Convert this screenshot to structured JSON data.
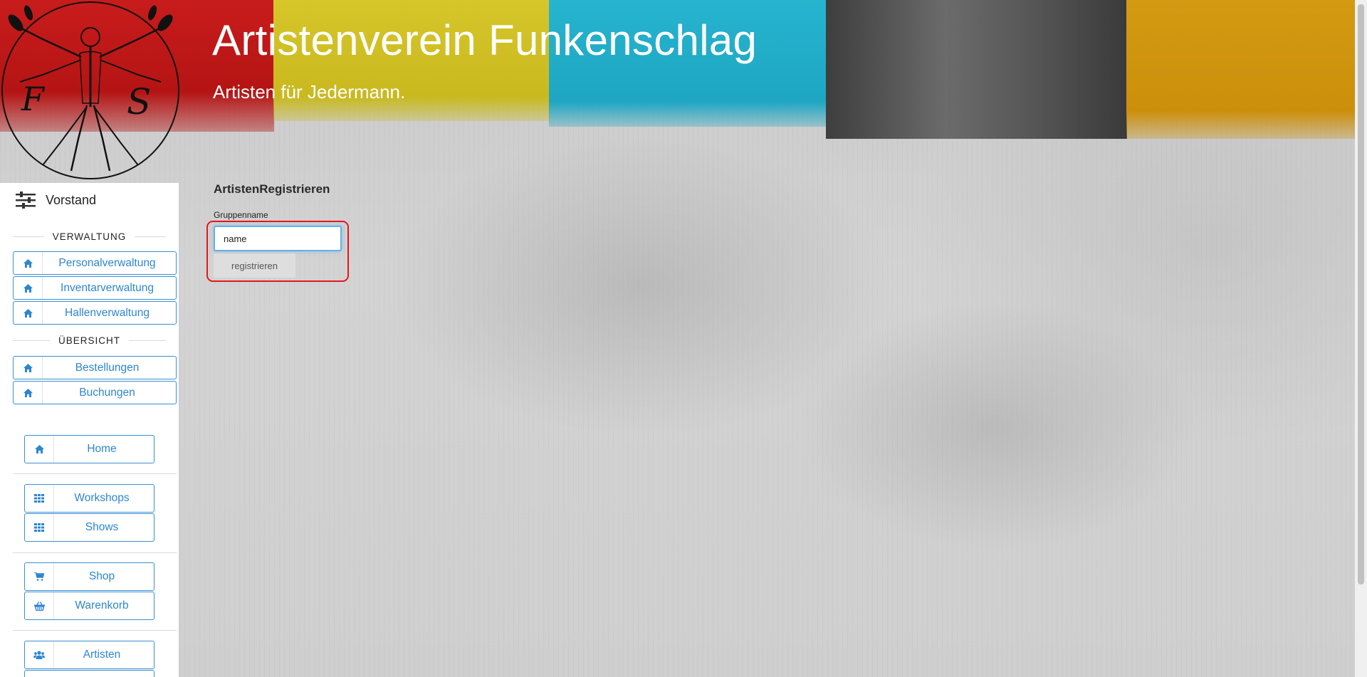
{
  "header": {
    "title": "Artistenverein Funkenschlag",
    "subtitle": "Artisten für Jedermann."
  },
  "sidebar": {
    "heading": "Vorstand",
    "section_admin": "VERWALTUNG",
    "section_overview": "ÜBERSICHT",
    "admin_items": [
      "Personalverwaltung",
      "Inventarverwaltung",
      "Hallenverwaltung"
    ],
    "overview_items": [
      "Bestellungen",
      "Buchungen"
    ],
    "nav": {
      "home": "Home",
      "workshops": "Workshops",
      "shows": "Shows",
      "shop": "Shop",
      "cart": "Warenkorb",
      "artists": "Artisten"
    }
  },
  "main": {
    "title": "ArtistenRegistrieren",
    "field_label": "Gruppenname",
    "input_value": "name",
    "submit_label": "registrieren"
  },
  "colors": {
    "link": "#2e86d1",
    "highlight": "#e1181f",
    "stripes": [
      "#c81c1c",
      "#d6c62a",
      "#26b4cf",
      "#4a4a4a",
      "#d39a12"
    ]
  }
}
